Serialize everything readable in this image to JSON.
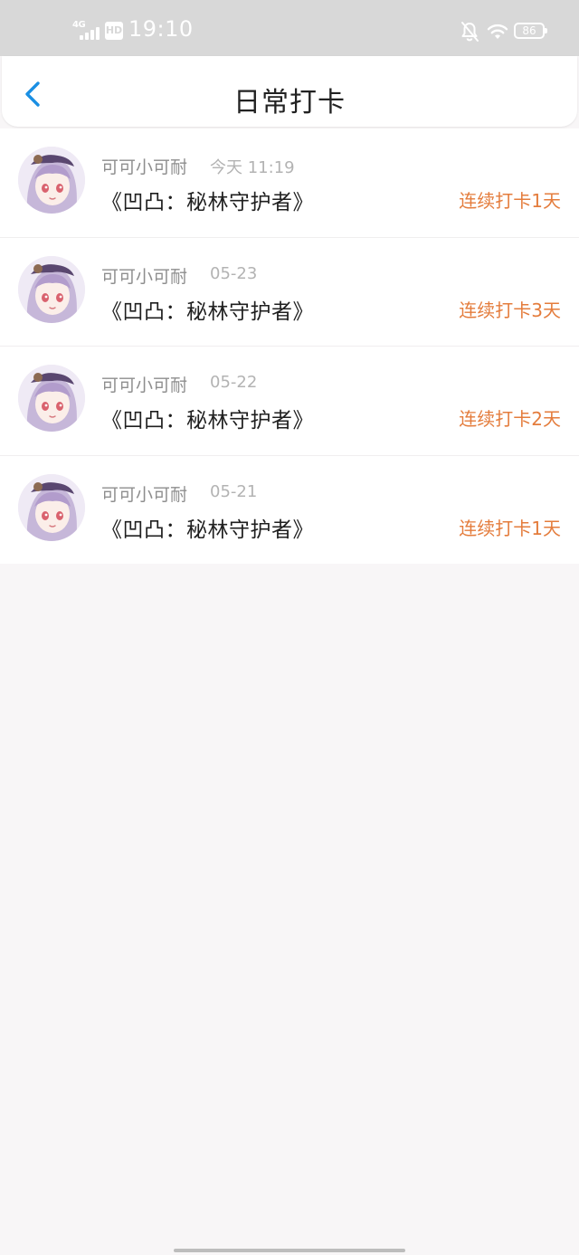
{
  "status_bar": {
    "network": "4G",
    "hd": "HD",
    "time": "19:10",
    "battery": "86",
    "icons": [
      "signal-bars-icon",
      "hd-icon",
      "bell-mute-icon",
      "wifi-icon",
      "battery-icon"
    ]
  },
  "header": {
    "title": "日常打卡",
    "back_icon": "chevron-left-icon"
  },
  "colors": {
    "accent_blue": "#1a8fe3",
    "streak_orange": "#e47c3c",
    "page_bg": "#f8f6f7"
  },
  "checkins": [
    {
      "name": "可可小可耐",
      "time": "今天 11:19",
      "game": "《凹凸：秘林守护者》",
      "streak": "连续打卡1天"
    },
    {
      "name": "可可小可耐",
      "time": "05-23",
      "game": "《凹凸：秘林守护者》",
      "streak": "连续打卡3天"
    },
    {
      "name": "可可小可耐",
      "time": "05-22",
      "game": "《凹凸：秘林守护者》",
      "streak": "连续打卡2天"
    },
    {
      "name": "可可小可耐",
      "time": "05-21",
      "game": "《凹凸：秘林守护者》",
      "streak": "连续打卡1天"
    }
  ]
}
